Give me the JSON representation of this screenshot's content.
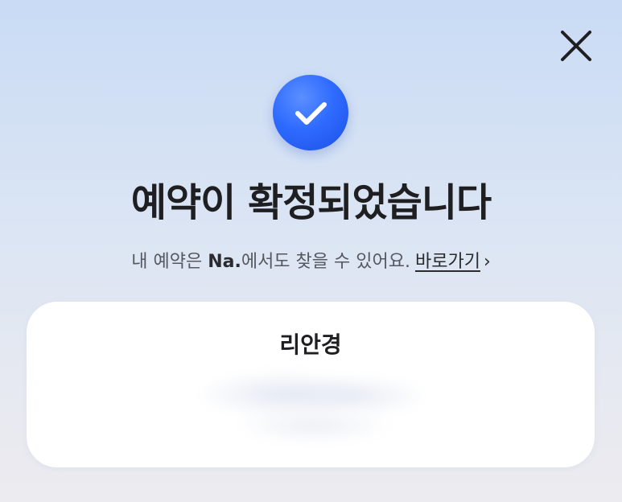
{
  "header": {
    "close_icon": "close-icon",
    "status_icon": "check-icon"
  },
  "title": "예약이 확정되었습니다",
  "subtitle": {
    "prefix": "내 예약은 ",
    "brand": "Na.",
    "suffix": "에서도 찾을 수 있어요.",
    "link_label": "바로가기",
    "link_chevron": "›"
  },
  "card": {
    "name": "리안경"
  },
  "colors": {
    "accent": "#2f6bff",
    "title_text": "#1f1f22",
    "subtitle_text": "#55585f",
    "card_background": "#ffffff"
  }
}
